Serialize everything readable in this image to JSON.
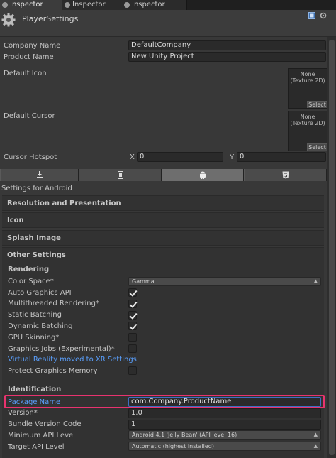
{
  "tabs": [
    {
      "label": "Inspector",
      "active": true
    },
    {
      "label": "Inspector",
      "active": false
    },
    {
      "label": "Inspector",
      "active": false
    }
  ],
  "header": {
    "title": "PlayerSettings",
    "icon": "gear-icon"
  },
  "company_name": {
    "label": "Company Name",
    "value": "DefaultCompany"
  },
  "product_name": {
    "label": "Product Name",
    "value": "New Unity Project"
  },
  "default_icon": {
    "label": "Default Icon",
    "box_text": "None\n(Texture 2D)",
    "select_label": "Select"
  },
  "default_cursor": {
    "label": "Default Cursor",
    "box_text": "None\n(Texture 2D)",
    "select_label": "Select"
  },
  "cursor_hotspot": {
    "label": "Cursor Hotspot",
    "x_label": "X",
    "x_value": "0",
    "y_label": "Y",
    "y_value": "0"
  },
  "platform_tabs": [
    "standalone-download-icon",
    "ios-device-icon",
    "android-icon",
    "html5-icon"
  ],
  "settings_for": "Settings for Android",
  "sections": {
    "resolution": "Resolution and Presentation",
    "icon": "Icon",
    "splash": "Splash Image",
    "other": "Other Settings"
  },
  "rendering": {
    "heading": "Rendering",
    "color_space": {
      "label": "Color Space*",
      "value": "Gamma"
    },
    "auto_graphics_api": {
      "label": "Auto Graphics API",
      "checked": true
    },
    "multithreaded": {
      "label": "Multithreaded Rendering*",
      "checked": true
    },
    "static_batching": {
      "label": "Static Batching",
      "checked": true
    },
    "dynamic_batching": {
      "label": "Dynamic Batching",
      "checked": true
    },
    "gpu_skinning": {
      "label": "GPU Skinning*",
      "checked": false
    },
    "graphics_jobs": {
      "label": "Graphics Jobs (Experimental)*",
      "checked": false
    },
    "vr_link": "Virtual Reality moved to XR Settings",
    "protect_graphics_memory": {
      "label": "Protect Graphics Memory",
      "checked": false
    }
  },
  "identification": {
    "heading": "Identification",
    "package_name": {
      "label": "Package Name",
      "value": "com.Company.ProductName"
    },
    "version": {
      "label": "Version*",
      "value": "1.0"
    },
    "bundle_version_code": {
      "label": "Bundle Version Code",
      "value": "1"
    },
    "min_api": {
      "label": "Minimum API Level",
      "value": "Android 4.1 'Jelly Bean' (API level 16)"
    },
    "target_api": {
      "label": "Target API Level",
      "value": "Automatic (highest installed)"
    }
  },
  "colors": {
    "highlight": "#e8336f",
    "link": "#5aa0ff",
    "background": "#383838"
  }
}
